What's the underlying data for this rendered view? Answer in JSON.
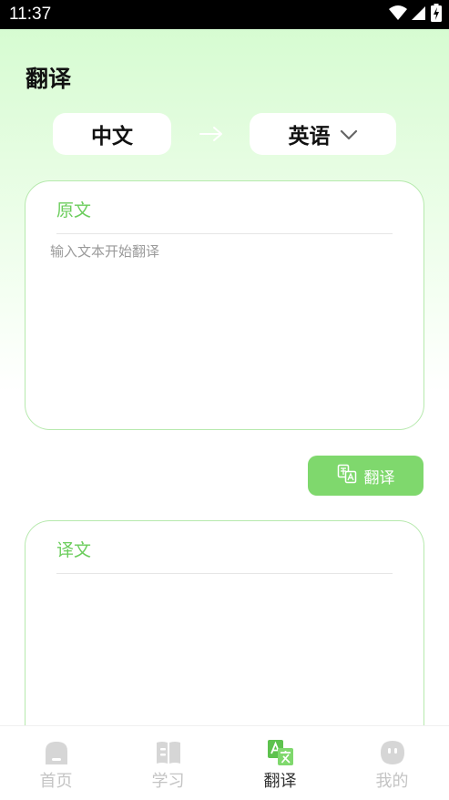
{
  "status_bar": {
    "time": "11:37"
  },
  "header": {
    "title": "翻译"
  },
  "languages": {
    "source": "中文",
    "target": "英语"
  },
  "source_card": {
    "label": "原文",
    "placeholder": "输入文本开始翻译"
  },
  "translate_button": {
    "label": "翻译"
  },
  "result_card": {
    "label": "译文"
  },
  "tab_bar": {
    "items": [
      {
        "label": "首页",
        "icon": "home-icon"
      },
      {
        "label": "学习",
        "icon": "book-icon"
      },
      {
        "label": "翻译",
        "icon": "translate-icon"
      },
      {
        "label": "我的",
        "icon": "profile-icon"
      }
    ],
    "active": "翻译"
  },
  "colors": {
    "accent": "#7fd86d",
    "label_green": "#6ccd5d",
    "card_border": "#b6e9ad"
  }
}
